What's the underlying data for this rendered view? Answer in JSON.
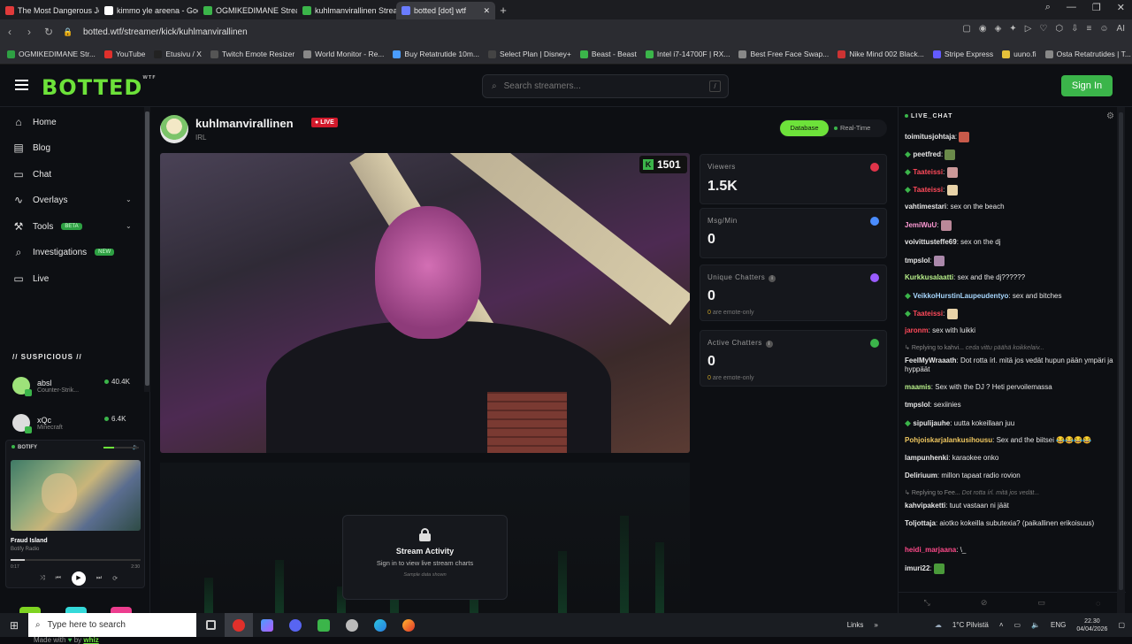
{
  "browser": {
    "tabs": [
      {
        "title": "The Most Dangerous Job i",
        "color": "#e03a3a"
      },
      {
        "title": "kimmo yle areena - Goog",
        "color": "#ffffff"
      },
      {
        "title": "OGMIKEDIMANE Stream",
        "color": "#3bb54a"
      },
      {
        "title": "kuhlmanvirallinen Stream",
        "color": "#3bb54a"
      },
      {
        "title": "botted [dot] wtf",
        "color": "#6a7cff"
      }
    ],
    "url": "botted.wtf/streamer/kick/kuhlmanvirallinen",
    "bookmarks": [
      "OGMIKEDIMANE Str...",
      "YouTube",
      "Etusivu / X",
      "Twitch Emote Resizer",
      "World Monitor - Re...",
      "Buy Retatrutide 10m...",
      "Select Plan | Disney+",
      "Beast - Beast",
      "Intel i7-14700F | RX...",
      "Best Free Face Swap...",
      "Nike Mind 002 Black...",
      "Stripe Express",
      "uuno.fi",
      "Osta Retatrutides | T..."
    ]
  },
  "header": {
    "logo": "BOTTED",
    "logo_sup": "WTF",
    "search_placeholder": "Search streamers...",
    "search_hint": "/",
    "signin": "Sign In"
  },
  "sidebar": {
    "items": [
      {
        "label": "Home",
        "icon": "home-icon"
      },
      {
        "label": "Blog",
        "icon": "blog-icon"
      },
      {
        "label": "Chat",
        "icon": "chat-icon"
      },
      {
        "label": "Overlays",
        "icon": "activity-icon"
      },
      {
        "label": "Tools",
        "icon": "wrench-icon",
        "badge": "BETA"
      },
      {
        "label": "Investigations",
        "icon": "search-icon",
        "badge": "NEW"
      },
      {
        "label": "Live",
        "icon": "tv-icon"
      }
    ],
    "suspicious_label": "// SUSPICIOUS //",
    "suspicious": [
      {
        "name": "absl",
        "game": "Counter-Strik...",
        "count": "40.4K"
      },
      {
        "name": "xQc",
        "game": "Minecraft",
        "count": "6.4K"
      }
    ],
    "player": {
      "header": "BOTIFY",
      "song": "Fraud Island",
      "artist": "Botify Radio",
      "elapsed": "0:17",
      "duration": "2:30",
      "progress": 0.11
    },
    "swatches": [
      "#7ed321",
      "#34d9d9",
      "#ec3d8e"
    ],
    "made_with": "Made with",
    "made_by": "by",
    "author": "whiz"
  },
  "stream": {
    "name": "kuhlmanvirallinen",
    "live": "LIVE",
    "category": "IRL",
    "mode_database": "Database",
    "mode_realtime": "Real-Time",
    "kick_viewers": "1501",
    "stats": [
      {
        "label": "Viewers",
        "value": "1.5K",
        "sub": "",
        "color": "#e0344a"
      },
      {
        "label": "Msg/Min",
        "value": "0",
        "sub": "",
        "color": "#4a8cff"
      },
      {
        "label": "Unique Chatters",
        "value": "0",
        "sub_num": "0",
        "sub": "are emote-only",
        "color": "#9a5cff"
      },
      {
        "label": "Active Chatters",
        "value": "0",
        "sub_num": "0",
        "sub": "are emote-only",
        "color": "#3bb54a"
      }
    ],
    "locked_card": {
      "title": "Stream Activity",
      "text": "Sign in to view live stream charts",
      "sample": "Sample data shown"
    }
  },
  "chat": {
    "title": "LIVE_CHAT",
    "messages": [
      {
        "user": "toimitusjohtaja",
        "text": "",
        "color": "#e6e6e6",
        "emote": "#c75a4a"
      },
      {
        "user": "peetfred",
        "text": "",
        "color": "#e6e6e6",
        "emote": "#6a8a4a",
        "sub": true
      },
      {
        "user": "Taateissi",
        "text": "",
        "color": "#ff4a5a",
        "emote": "#c99",
        "sub": true
      },
      {
        "user": "Taateissi",
        "text": "",
        "color": "#ff4a5a",
        "emote": "#e8d3a8",
        "sub": true
      },
      {
        "user": "vahtimestari",
        "text": "sex on the beach",
        "color": "#e6e6e6"
      },
      {
        "user": "JemiWuU",
        "text": "",
        "color": "#ff9ad5",
        "emote": "#b89"
      },
      {
        "user": "voivittusteffe69",
        "text": "sex on the dj",
        "color": "#e6e6e6"
      },
      {
        "user": "tmpslol",
        "text": "",
        "color": "#e6e6e6",
        "emote": "#a8a"
      },
      {
        "user": "Kurkkusalaatti",
        "text": "sex and the dj??????",
        "color": "#b8f08a"
      },
      {
        "user": "VeikkoHurstinLaupeudentyo",
        "text": "sex and bitches",
        "color": "#a8d8ff",
        "sub": true
      },
      {
        "user": "Taateissi",
        "text": "",
        "color": "#ff4a5a",
        "emote": "#e8d3a8",
        "sub": true
      },
      {
        "user": "jaronm",
        "text": "sex with luikki",
        "color": "#ff4a5a"
      },
      {
        "user": "",
        "reply": "Replying to kahvi...",
        "reply_text": "ceda vittu päähä koikkelaiv...",
        "color": "#888"
      },
      {
        "user": "FeelMyWraaath",
        "text": "Dot rotta írl. mitä jos vedät hupun pään ympäri ja hyppäät",
        "color": "#e6e6e6"
      },
      {
        "user": "maamis",
        "text": "Sex with the DJ ? Heti pervoilemassa",
        "color": "#b8f08a"
      },
      {
        "user": "tmpslol",
        "text": "sexiinies",
        "color": "#e6e6e6"
      },
      {
        "user": "sipulijauhe",
        "text": "uutta kokeillaan juu",
        "color": "#e6e6e6",
        "sub": true
      },
      {
        "user": "Pohjoiskarjalankusihousu",
        "text": "Sex and the biitsei 😂😂😂😂",
        "color": "#f0c860"
      },
      {
        "user": "lampunhenki",
        "text": "karaokee onko",
        "color": "#e6e6e6"
      },
      {
        "user": "Deliriuum",
        "text": "millon tapaat radio rovion",
        "color": "#e6e6e6"
      },
      {
        "user": "",
        "reply": "Replying to Fee...",
        "reply_text": "Dot rotta írl. mitä jos vedät...",
        "color": "#888"
      },
      {
        "user": "kahvipaketti",
        "text": "tuut vastaan ni jäät",
        "color": "#e6e6e6"
      },
      {
        "user": "Toljottaja",
        "text": "aiotko kokeilla subutexia? (paikallinen erikoisuus)",
        "color": "#e6e6e6"
      },
      {
        "user": "heidi_marjaana",
        "text": "\\_",
        "color": "#ff4a8a"
      },
      {
        "user": "imuri22",
        "text": "",
        "color": "#e6e6e6",
        "emote": "#4a9a3a"
      }
    ]
  },
  "taskbar": {
    "search_placeholder": "Type here to search",
    "links": "Links",
    "weather": "1°C  Pilvistä",
    "lang": "ENG",
    "time": "22.30",
    "date": "04/04/2026"
  }
}
